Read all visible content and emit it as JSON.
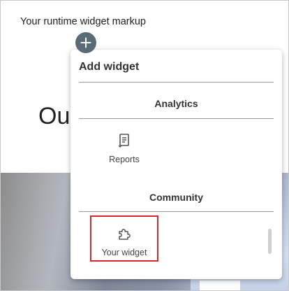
{
  "page": {
    "runtime_label": "Your runtime widget markup",
    "hero_text": "Ou"
  },
  "add_button": {
    "icon": "plus-icon",
    "color": "#5a6b78"
  },
  "popup": {
    "title": "Add widget",
    "sections": [
      {
        "title": "Analytics",
        "items": [
          {
            "label": "Reports",
            "icon": "reports-icon"
          }
        ]
      },
      {
        "title": "Community",
        "items": [
          {
            "label": "Your widget",
            "icon": "puzzle-icon"
          }
        ]
      }
    ],
    "highlight_color": "#d9252c"
  }
}
